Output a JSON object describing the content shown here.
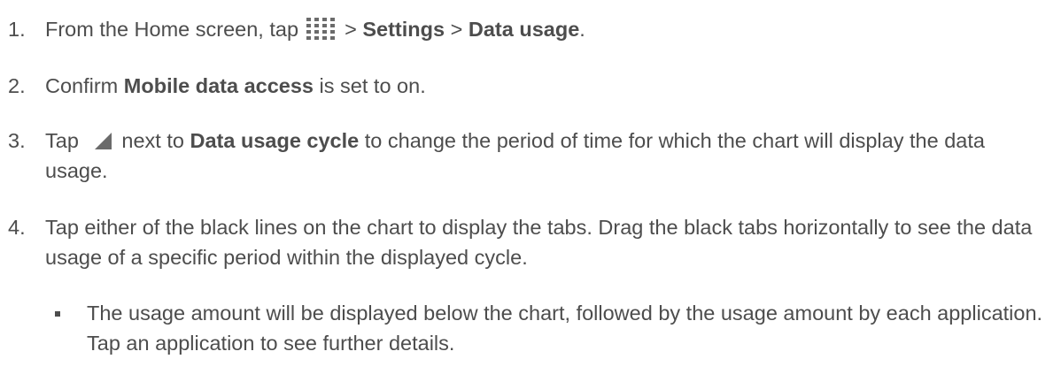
{
  "steps": [
    {
      "num": "1.",
      "t1": "From the Home screen, tap ",
      "t2": " > ",
      "b1": "Settings",
      "t3": " > ",
      "b2": "Data usage",
      "t4": "."
    },
    {
      "num": "2.",
      "t1": "Confirm ",
      "b1": "Mobile data access",
      "t2": " is set to on."
    },
    {
      "num": "3.",
      "t1": "Tap ",
      "t2": "next to ",
      "b1": "Data usage cycle",
      "t3": " to change the period of time for which the chart will display the data usage."
    },
    {
      "num": "4.",
      "t1": "Tap either of the black lines on the chart to display the tabs. Drag the black tabs horizontally to see the data usage of a specific period within the displayed cycle."
    }
  ],
  "bullet": {
    "text": "The usage amount will be displayed below the chart, followed by the usage amount by each application. Tap an application to see further details."
  },
  "icons": {
    "apps": "apps-grid-icon",
    "dropdown": "dropdown-triangle-icon"
  },
  "colors": {
    "text": "#4d4d4d",
    "icon": "#6b6b6b"
  }
}
